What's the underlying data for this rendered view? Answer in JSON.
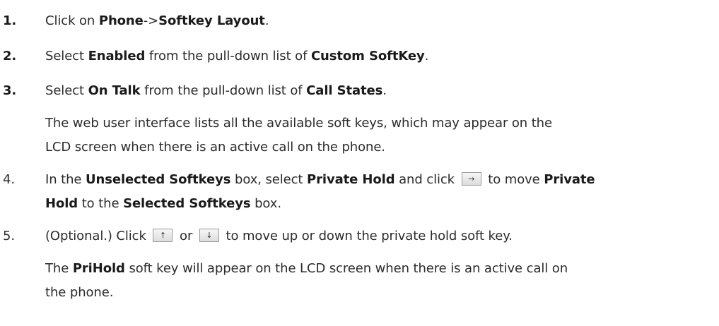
{
  "steps": [
    {
      "number": "1.",
      "text": [
        "Click on ",
        "Phone",
        "->",
        "Softkey Layout",
        "."
      ]
    },
    {
      "number": "2.",
      "text": [
        "Select ",
        "Enabled",
        " from the pull-down list of ",
        "Custom SoftKey",
        "."
      ]
    },
    {
      "number": "3.",
      "text": [
        "Select ",
        "On Talk",
        " from the pull-down list of ",
        "Call States",
        "."
      ],
      "note_lines": [
        "The web user interface lists all the available soft keys, which may appear on the",
        "LCD screen when there is an active call on the phone."
      ]
    },
    {
      "number": "4.",
      "line1": [
        "In the ",
        "Unselected Softkeys",
        " box, select ",
        "Private Hold",
        " and click ",
        " to move ",
        "Private"
      ],
      "line2": [
        "Hold",
        " to the ",
        "Selected Softkeys",
        " box."
      ]
    },
    {
      "number": "5.",
      "line1": [
        "(Optional.) Click ",
        " or ",
        " to move up or down the private hold soft key."
      ],
      "note_line1": [
        "The ",
        "PriHold",
        " soft key will appear on the LCD screen when there is an active call on"
      ],
      "note_line2": "the phone."
    }
  ],
  "buttons": {
    "move_right_glyph": "→",
    "move_up_glyph": "↑",
    "move_down_glyph": "↓"
  }
}
